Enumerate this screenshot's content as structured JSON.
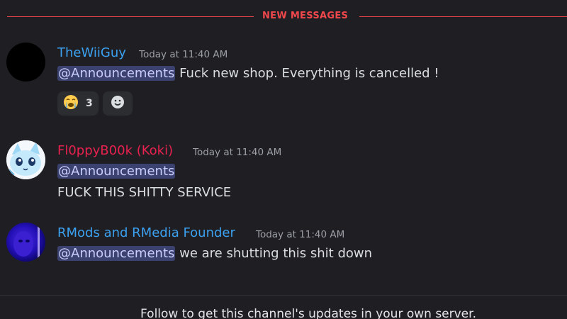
{
  "divider": {
    "label": "NEW MESSAGES"
  },
  "messages": [
    {
      "username": "TheWiiGuy",
      "username_color": "#3ba1f0",
      "timestamp": "Today at 11:40 AM",
      "mention": "@Announcements",
      "text": " Fuck new shop. Everything is cancelled !",
      "reactions": [
        {
          "emoji": "crying-face-icon",
          "count": "3"
        },
        {
          "emoji": "add-reaction-icon",
          "count": ""
        }
      ]
    },
    {
      "username": "Fl0ppyB00k (Koki)",
      "username_color": "#e8214f",
      "timestamp": "Today at 11:40 AM",
      "mention": "@Announcements",
      "text": "FUCK THIS SHITTY SERVICE"
    },
    {
      "username": "RMods and RMedia Founder",
      "username_color": "#3ba1f0",
      "timestamp": "Today at 11:40 AM",
      "mention": "@Announcements",
      "text": " we are shutting this shit down"
    }
  ],
  "footer": {
    "follow_text": "Follow to get this channel's updates in your own server."
  }
}
